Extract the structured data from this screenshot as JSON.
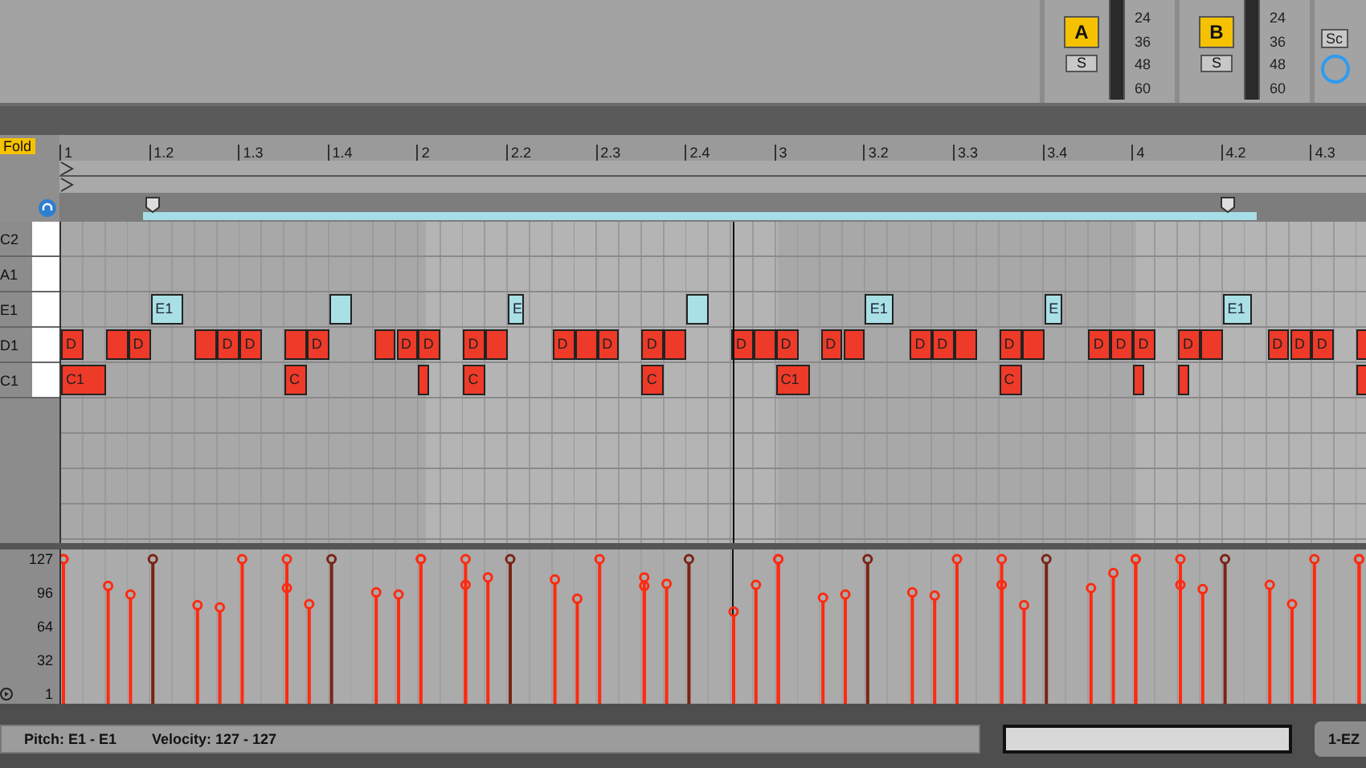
{
  "mixer": {
    "channels": [
      {
        "label": "A",
        "solo": "S",
        "scale": [
          "24",
          "36",
          "48",
          "60"
        ]
      },
      {
        "label": "B",
        "solo": "S",
        "scale": [
          "24",
          "36",
          "48",
          "60"
        ]
      }
    ],
    "partial_button": "Sc"
  },
  "ruler": {
    "fold": "Fold",
    "beats": [
      "1",
      "1.2",
      "1.3",
      "1.4",
      "2",
      "2.2",
      "2.3",
      "2.4",
      "3",
      "3.2",
      "3.3",
      "3.4",
      "4",
      "4.2",
      "4.3"
    ]
  },
  "keys": [
    {
      "label": "C2"
    },
    {
      "label": "A1"
    },
    {
      "label": "E1",
      "notes": [
        {
          "label": "E1",
          "selected": true
        },
        {
          "selected": true
        },
        {
          "label": "E",
          "selected": true
        },
        {
          "selected": true
        },
        {
          "label": "E1",
          "selected": true
        },
        {
          "label": "E",
          "selected": true
        },
        {
          "label": "E1",
          "selected": true
        }
      ]
    },
    {
      "label": "D1",
      "notes": [
        {
          "label": "D",
          "selected": false
        },
        {
          "selected": false
        },
        {
          "label": "D",
          "selected": false
        },
        {
          "selected": false
        },
        {
          "label": "D",
          "selected": false
        },
        {
          "label": "D",
          "selected": false
        },
        {
          "selected": false
        },
        {
          "label": "D",
          "selected": false
        },
        {
          "selected": false
        },
        {
          "label": "D",
          "selected": false
        },
        {
          "label": "D",
          "selected": false
        },
        {
          "label": "D",
          "selected": false
        },
        {
          "selected": false
        },
        {
          "label": "D",
          "selected": false
        },
        {
          "selected": false
        },
        {
          "label": "D",
          "selected": false
        },
        {
          "label": "D",
          "selected": false
        },
        {
          "selected": false
        },
        {
          "label": "D",
          "selected": false
        },
        {
          "selected": false
        },
        {
          "label": "D",
          "selected": false
        },
        {
          "label": "D",
          "selected": false
        },
        {
          "selected": false
        },
        {
          "label": "D",
          "selected": false
        },
        {
          "label": "D",
          "selected": false
        },
        {
          "selected": false
        },
        {
          "label": "D",
          "selected": false
        },
        {
          "selected": false
        },
        {
          "label": "D",
          "selected": false
        },
        {
          "label": "D",
          "selected": false
        },
        {
          "label": "D",
          "selected": false
        },
        {
          "label": "D",
          "selected": false
        },
        {
          "selected": false
        },
        {
          "label": "D",
          "selected": false
        },
        {
          "label": "D",
          "selected": false
        },
        {
          "label": "D",
          "selected": false
        },
        {
          "selected": false
        }
      ]
    },
    {
      "label": "C1",
      "notes": [
        {
          "label": "C1",
          "selected": false
        },
        {
          "label": "C",
          "selected": false
        },
        {
          "selected": false
        },
        {
          "label": "C",
          "selected": false
        },
        {
          "label": "C",
          "selected": false
        },
        {
          "label": "C1",
          "selected": false
        },
        {
          "label": "C",
          "selected": false
        },
        {
          "selected": false
        },
        {
          "selected": false
        },
        {
          "selected": false
        }
      ]
    }
  ],
  "velocity_scale": [
    "127",
    "96",
    "64",
    "32",
    "1"
  ],
  "status_bar": {
    "pitch": "Pitch: E1 - E1",
    "velocity": "Velocity: 127 - 127",
    "tab": "1-EZ"
  }
}
